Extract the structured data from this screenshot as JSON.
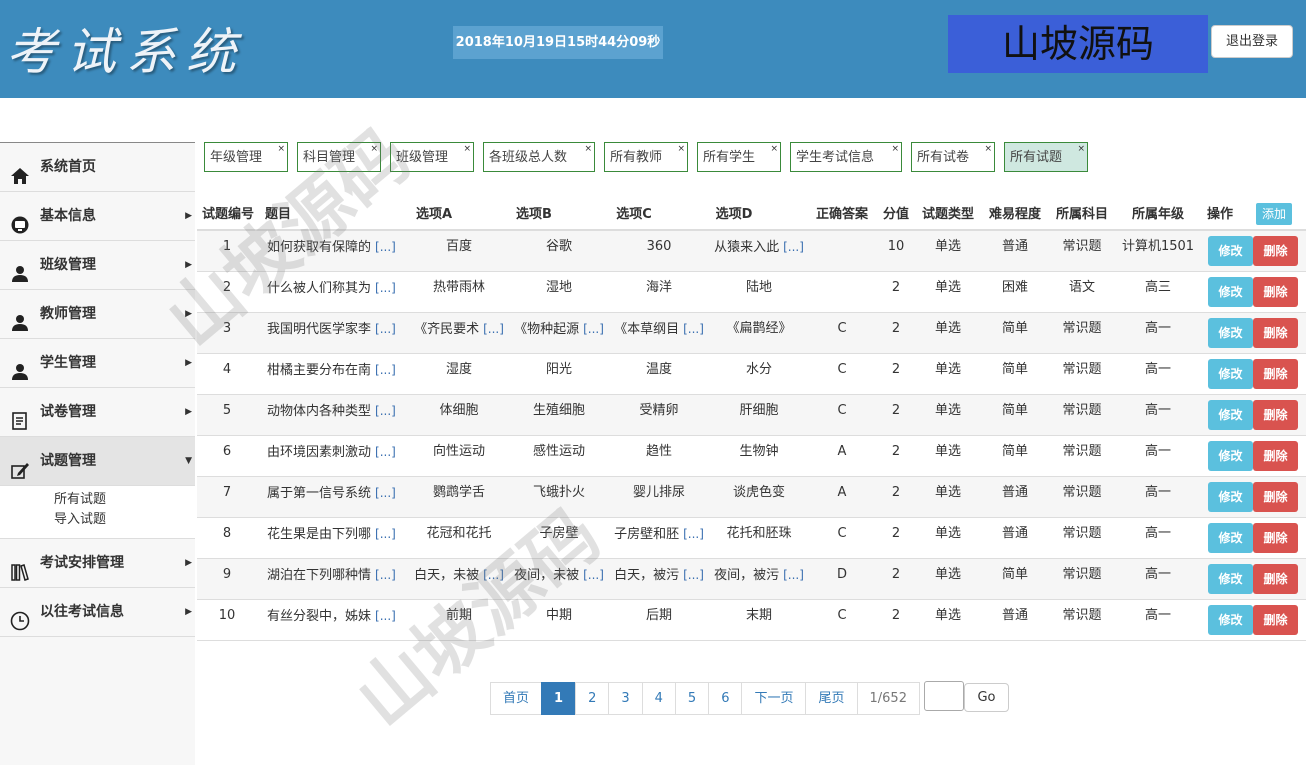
{
  "header": {
    "logo": "考试系统",
    "datetime": "2018年10月19日15时44分09秒",
    "brand": "山坡源码",
    "logout_label": "退出登录"
  },
  "sidebar": {
    "items": [
      {
        "label": "系统首页",
        "icon": "home-icon"
      },
      {
        "label": "基本信息",
        "icon": "info-icon"
      },
      {
        "label": "班级管理",
        "icon": "user-icon"
      },
      {
        "label": "教师管理",
        "icon": "user-icon"
      },
      {
        "label": "学生管理",
        "icon": "user-icon"
      },
      {
        "label": "试卷管理",
        "icon": "document-icon"
      },
      {
        "label": "试题管理",
        "icon": "edit-icon"
      },
      {
        "label": "考试安排管理",
        "icon": "books-icon"
      },
      {
        "label": "以往考试信息",
        "icon": "clock-icon"
      }
    ],
    "subitems": [
      "所有试题",
      "导入试题"
    ]
  },
  "tabs": [
    "年级管理",
    "科目管理",
    "班级管理",
    "各班级总人数",
    "所有教师",
    "所有学生",
    "学生考试信息",
    "所有试卷",
    "所有试题"
  ],
  "tab_close": "×",
  "table": {
    "headers": [
      "试题编号",
      "题目",
      "选项A",
      "选项B",
      "选项C",
      "选项D",
      "正确答案",
      "分值",
      "试题类型",
      "难易程度",
      "所属科目",
      "所属年级",
      "操作"
    ],
    "add_label": "添加",
    "edit_label": "修改",
    "delete_label": "删除",
    "more": "[...]",
    "rows": [
      {
        "id": "1",
        "q": "如何获取有保障的",
        "a": "百度",
        "b": "谷歌",
        "c": "360",
        "d": "从猿来入此",
        "ans": "",
        "score": "10",
        "type": "单选",
        "diff": "普通",
        "subject": "常识题",
        "grade": "计算机1501"
      },
      {
        "id": "2",
        "q": "什么被人们称其为",
        "a": "热带雨林",
        "b": "湿地",
        "c": "海洋",
        "d": "陆地",
        "ans": "",
        "score": "2",
        "type": "单选",
        "diff": "困难",
        "subject": "语文",
        "grade": "高三"
      },
      {
        "id": "3",
        "q": "我国明代医学家李",
        "a": "《齐民要术",
        "b": "《物种起源",
        "c": "《本草纲目",
        "d": "《扁鹊经》",
        "ans": "C",
        "score": "2",
        "type": "单选",
        "diff": "简单",
        "subject": "常识题",
        "grade": "高一"
      },
      {
        "id": "4",
        "q": "柑橘主要分布在南",
        "a": "湿度",
        "b": "阳光",
        "c": "温度",
        "d": "水分",
        "ans": "C",
        "score": "2",
        "type": "单选",
        "diff": "简单",
        "subject": "常识题",
        "grade": "高一"
      },
      {
        "id": "5",
        "q": "动物体内各种类型",
        "a": "体细胞",
        "b": "生殖细胞",
        "c": "受精卵",
        "d": "肝细胞",
        "ans": "C",
        "score": "2",
        "type": "单选",
        "diff": "简单",
        "subject": "常识题",
        "grade": "高一"
      },
      {
        "id": "6",
        "q": "由环境因素刺激动",
        "a": "向性运动",
        "b": "感性运动",
        "c": "趋性",
        "d": "生物钟",
        "ans": "A",
        "score": "2",
        "type": "单选",
        "diff": "简单",
        "subject": "常识题",
        "grade": "高一"
      },
      {
        "id": "7",
        "q": "属于第一信号系统",
        "a": "鹦鹉学舌",
        "b": "飞蛾扑火",
        "c": "婴儿排尿",
        "d": "谈虎色变",
        "ans": "A",
        "score": "2",
        "type": "单选",
        "diff": "普通",
        "subject": "常识题",
        "grade": "高一"
      },
      {
        "id": "8",
        "q": "花生果是由下列哪",
        "a": "花冠和花托",
        "b": "子房壁",
        "c": "子房壁和胚",
        "d": "花托和胚珠",
        "ans": "C",
        "score": "2",
        "type": "单选",
        "diff": "普通",
        "subject": "常识题",
        "grade": "高一"
      },
      {
        "id": "9",
        "q": "湖泊在下列哪种情",
        "a": "白天，未被",
        "b": "夜间，未被",
        "c": "白天，被污",
        "d": "夜间，被污",
        "ans": "D",
        "score": "2",
        "type": "单选",
        "diff": "简单",
        "subject": "常识题",
        "grade": "高一"
      },
      {
        "id": "10",
        "q": "有丝分裂中，姊妹",
        "a": "前期",
        "b": "中期",
        "c": "后期",
        "d": "末期",
        "ans": "C",
        "score": "2",
        "type": "单选",
        "diff": "普通",
        "subject": "常识题",
        "grade": "高一"
      }
    ],
    "more_cols": [
      [
        "q",
        "d"
      ],
      [
        "q"
      ],
      [
        "q",
        "a",
        "b",
        "c"
      ],
      [
        "q"
      ],
      [
        "q"
      ],
      [
        "q"
      ],
      [
        "q"
      ],
      [
        "q",
        "c"
      ],
      [
        "q",
        "a",
        "b",
        "c",
        "d"
      ],
      [
        "q"
      ]
    ]
  },
  "pagination": {
    "first": "首页",
    "pages": [
      "1",
      "2",
      "3",
      "4",
      "5",
      "6"
    ],
    "current": "1",
    "next": "下一页",
    "last": "尾页",
    "info": "1/652",
    "go": "Go"
  },
  "watermark": "山坡源码"
}
